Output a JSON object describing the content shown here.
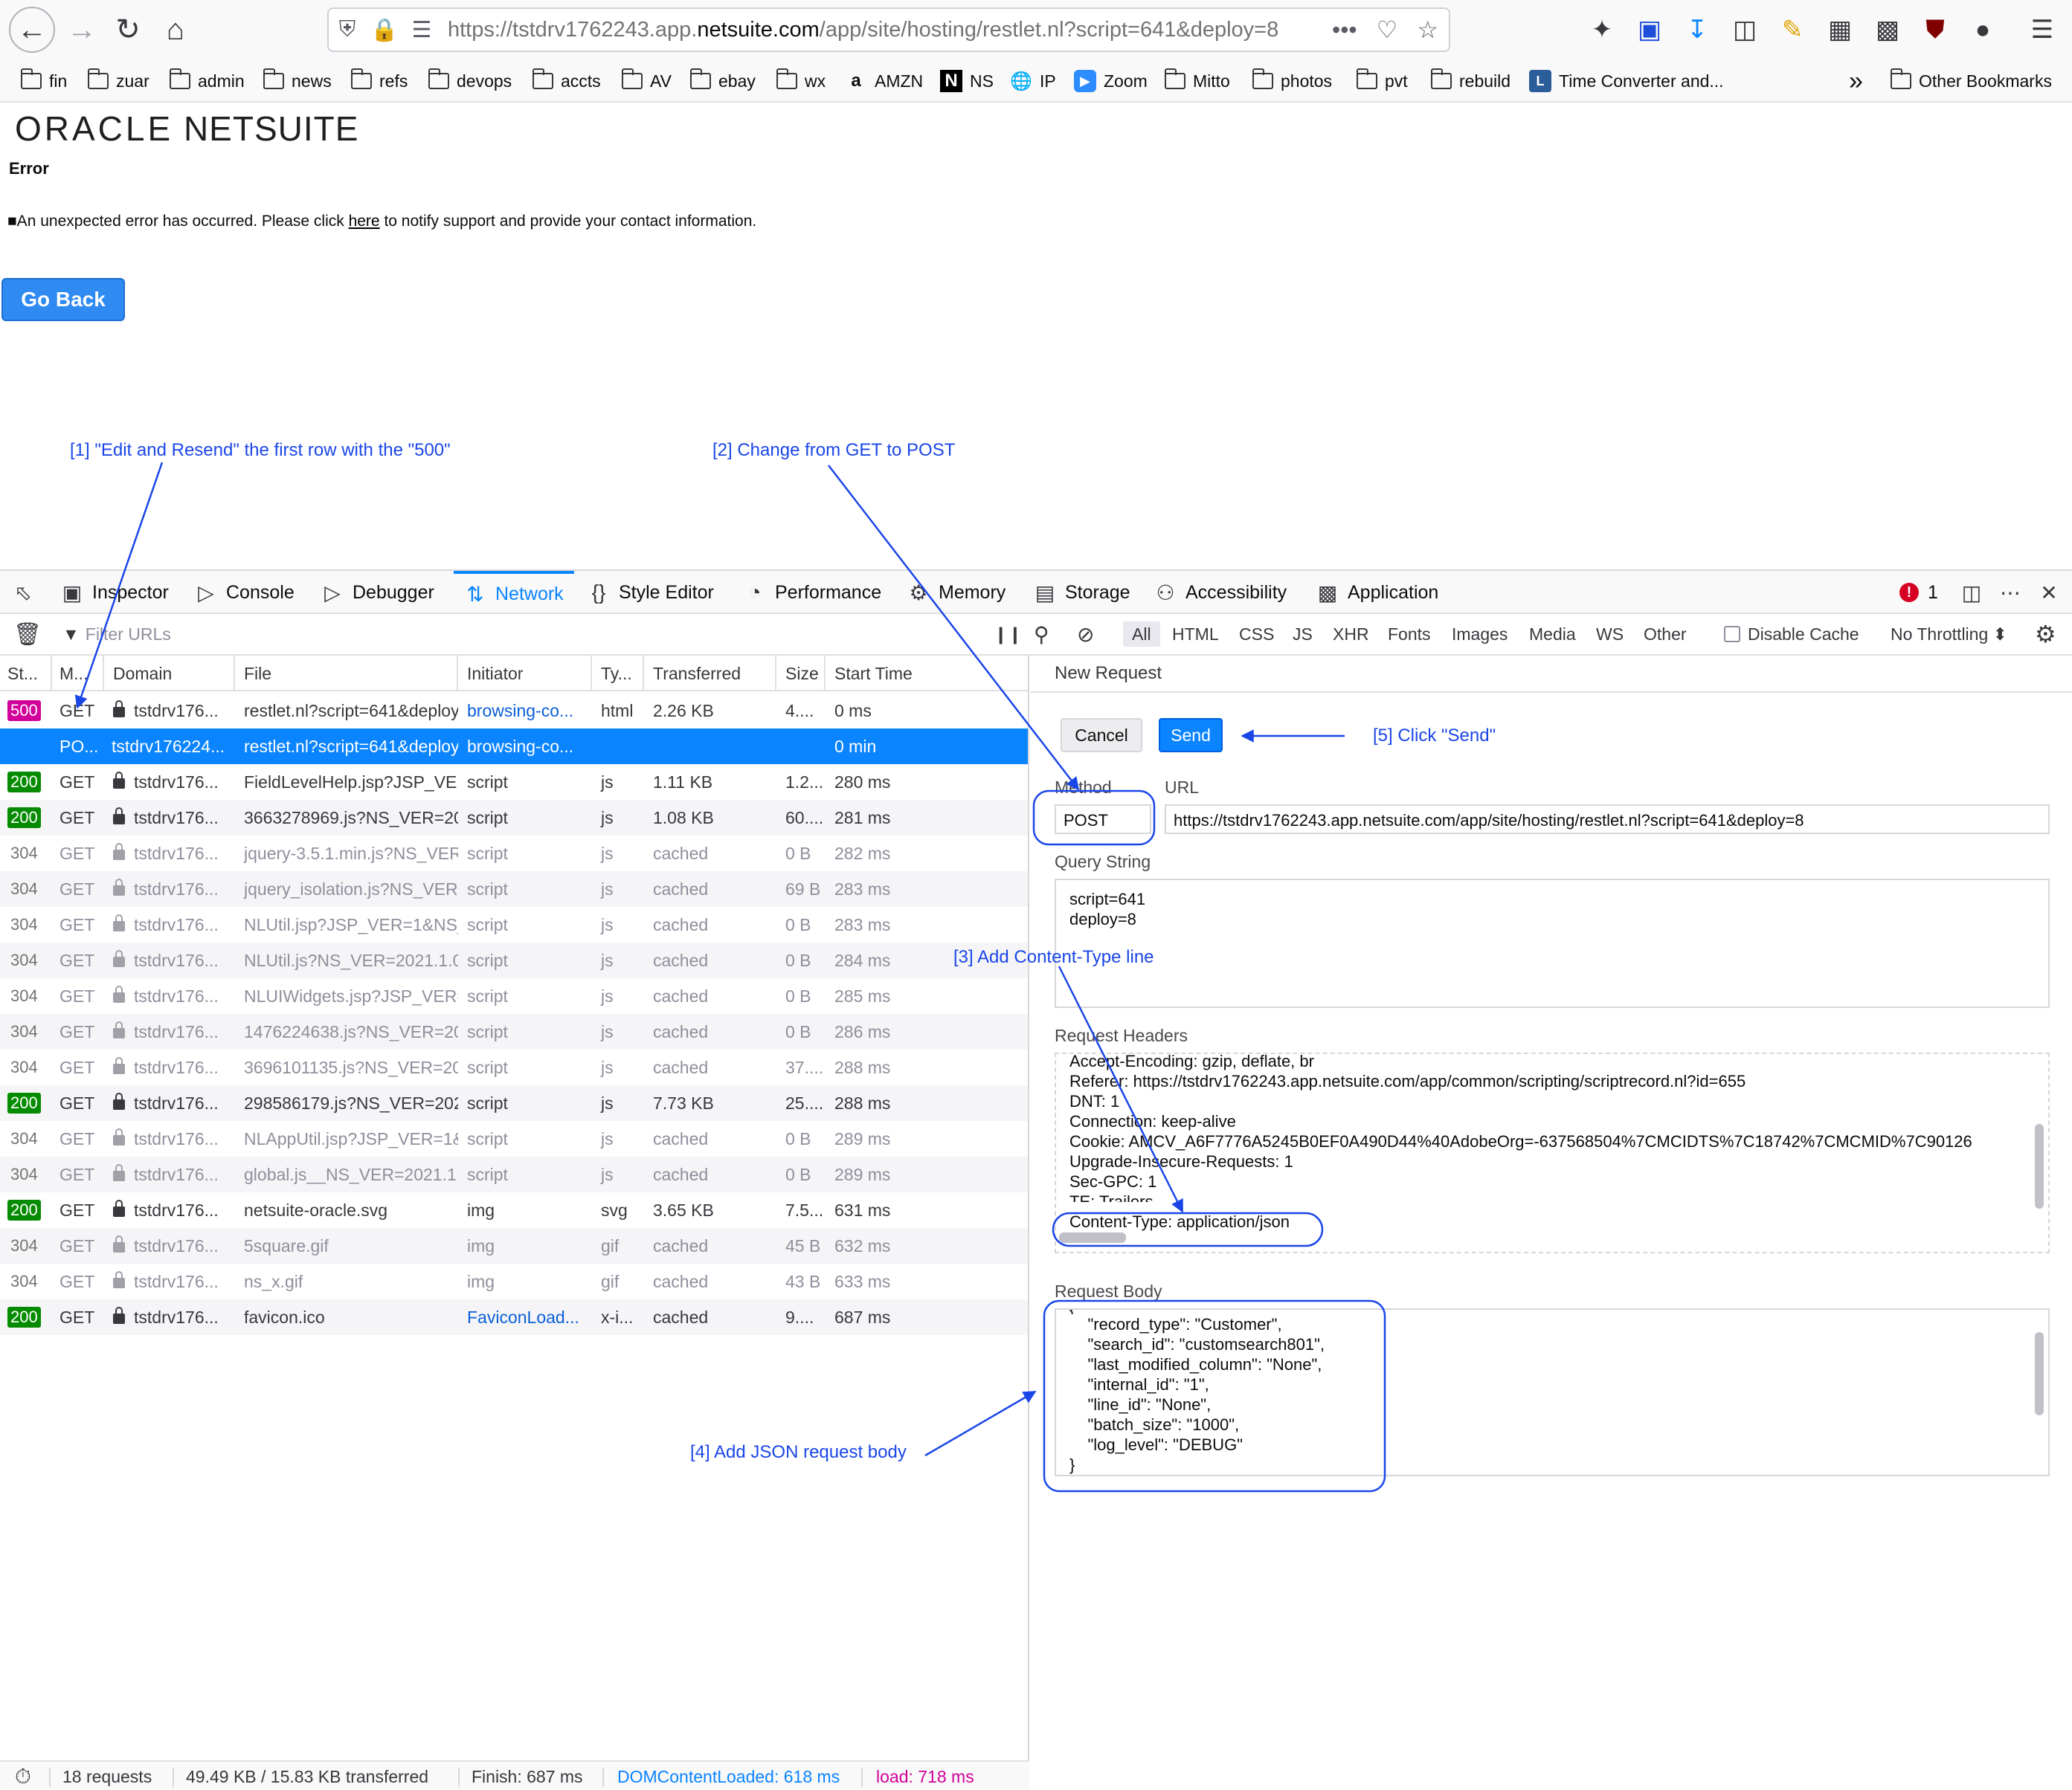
{
  "browser": {
    "url_prefix": "https://tstdrv1762243.app.",
    "url_domain": "netsuite.com",
    "url_path": "/app/site/hosting/restlet.nl?script=641&deploy=8",
    "url_more": "•••",
    "bookmarks": [
      "fin",
      "zuar",
      "admin",
      "news",
      "refs",
      "devops",
      "accts",
      "AV",
      "ebay",
      "wx",
      "AMZN",
      "NS",
      "IP",
      "Zoom",
      "Mitto",
      "photos",
      "pvt",
      "rebuild",
      "Time Converter and...",
      "Other Bookmarks"
    ],
    "bookmarks_more": "»"
  },
  "page": {
    "logo_oracle": "ORACLE",
    "logo_netsuite": "NETSUITE",
    "error_title": "Error",
    "error_prefix": "■An unexpected error has occurred. Please click ",
    "error_link": "here",
    "error_suffix": " to notify support and provide your contact information.",
    "go_back": "Go Back"
  },
  "annotations": {
    "step1": "[1] \"Edit and Resend\" the first row with the \"500\"",
    "step2": "[2] Change from GET to POST",
    "step3": "[3] Add Content-Type line",
    "step4": "[4] Add JSON request body",
    "step5": "[5] Click \"Send\""
  },
  "devtools": {
    "tabs": [
      "Inspector",
      "Console",
      "Debugger",
      "Network",
      "Style Editor",
      "Performance",
      "Memory",
      "Storage",
      "Accessibility",
      "Application"
    ],
    "error_count": "1",
    "filter_placeholder": "Filter URLs",
    "type_filters": [
      "All",
      "HTML",
      "CSS",
      "JS",
      "XHR",
      "Fonts",
      "Images",
      "Media",
      "WS",
      "Other"
    ],
    "disable_cache": "Disable Cache",
    "throttling": "No Throttling ⬍",
    "columns": [
      "St...",
      "M...",
      "Domain",
      "File",
      "Initiator",
      "Ty...",
      "Transferred",
      "Size",
      "Start Time"
    ],
    "rows": [
      {
        "status": "500",
        "method": "GET",
        "domain": "tstdrv176...",
        "file": "restlet.nl?script=641&deploy",
        "initiator": "browsing-co...",
        "type": "html",
        "transferred": "2.26 KB",
        "size": "4....",
        "start": "0 ms"
      },
      {
        "status": "",
        "method": "PO...",
        "domain": "tstdrv176224...",
        "file": "restlet.nl?script=641&deploy",
        "initiator": "browsing-co...",
        "type": "",
        "transferred": "",
        "size": "",
        "start": "0 min"
      },
      {
        "status": "200",
        "method": "GET",
        "domain": "tstdrv176...",
        "file": "FieldLevelHelp.jsp?JSP_VER",
        "initiator": "script",
        "type": "js",
        "transferred": "1.11 KB",
        "size": "1.2...",
        "start": "280 ms"
      },
      {
        "status": "200",
        "method": "GET",
        "domain": "tstdrv176...",
        "file": "3663278969.js?NS_VER=20",
        "initiator": "script",
        "type": "js",
        "transferred": "1.08 KB",
        "size": "60....",
        "start": "281 ms"
      },
      {
        "status": "304",
        "method": "GET",
        "domain": "tstdrv176...",
        "file": "jquery-3.5.1.min.js?NS_VER=",
        "initiator": "script",
        "type": "js",
        "transferred": "cached",
        "size": "0 B",
        "start": "282 ms"
      },
      {
        "status": "304",
        "method": "GET",
        "domain": "tstdrv176...",
        "file": "jquery_isolation.js?NS_VER=",
        "initiator": "script",
        "type": "js",
        "transferred": "cached",
        "size": "69 B",
        "start": "283 ms"
      },
      {
        "status": "304",
        "method": "GET",
        "domain": "tstdrv176...",
        "file": "NLUtil.jsp?JSP_VER=1&NS_V",
        "initiator": "script",
        "type": "js",
        "transferred": "cached",
        "size": "0 B",
        "start": "283 ms"
      },
      {
        "status": "304",
        "method": "GET",
        "domain": "tstdrv176...",
        "file": "NLUtil.js?NS_VER=2021.1.0&",
        "initiator": "script",
        "type": "js",
        "transferred": "cached",
        "size": "0 B",
        "start": "284 ms"
      },
      {
        "status": "304",
        "method": "GET",
        "domain": "tstdrv176...",
        "file": "NLUIWidgets.jsp?JSP_VER=1",
        "initiator": "script",
        "type": "js",
        "transferred": "cached",
        "size": "0 B",
        "start": "285 ms"
      },
      {
        "status": "304",
        "method": "GET",
        "domain": "tstdrv176...",
        "file": "1476224638.js?NS_VER=20",
        "initiator": "script",
        "type": "js",
        "transferred": "cached",
        "size": "0 B",
        "start": "286 ms"
      },
      {
        "status": "304",
        "method": "GET",
        "domain": "tstdrv176...",
        "file": "3696101135.js?NS_VER=202",
        "initiator": "script",
        "type": "js",
        "transferred": "cached",
        "size": "37....",
        "start": "288 ms"
      },
      {
        "status": "200",
        "method": "GET",
        "domain": "tstdrv176...",
        "file": "298586179.js?NS_VER=202",
        "initiator": "script",
        "type": "js",
        "transferred": "7.73 KB",
        "size": "25....",
        "start": "288 ms"
      },
      {
        "status": "304",
        "method": "GET",
        "domain": "tstdrv176...",
        "file": "NLAppUtil.jsp?JSP_VER=1&N",
        "initiator": "script",
        "type": "js",
        "transferred": "cached",
        "size": "0 B",
        "start": "289 ms"
      },
      {
        "status": "304",
        "method": "GET",
        "domain": "tstdrv176...",
        "file": "global.js__NS_VER=2021.1.0",
        "initiator": "script",
        "type": "js",
        "transferred": "cached",
        "size": "0 B",
        "start": "289 ms"
      },
      {
        "status": "200",
        "method": "GET",
        "domain": "tstdrv176...",
        "file": "netsuite-oracle.svg",
        "initiator": "img",
        "type": "svg",
        "transferred": "3.65 KB",
        "size": "7.5...",
        "start": "631 ms"
      },
      {
        "status": "304",
        "method": "GET",
        "domain": "tstdrv176...",
        "file": "5square.gif",
        "initiator": "img",
        "type": "gif",
        "transferred": "cached",
        "size": "45 B",
        "start": "632 ms"
      },
      {
        "status": "304",
        "method": "GET",
        "domain": "tstdrv176...",
        "file": "ns_x.gif",
        "initiator": "img",
        "type": "gif",
        "transferred": "cached",
        "size": "43 B",
        "start": "633 ms"
      },
      {
        "status": "200",
        "method": "GET",
        "domain": "tstdrv176...",
        "file": "favicon.ico",
        "initiator": "FaviconLoad...",
        "type": "x-i...",
        "transferred": "cached",
        "size": "9....",
        "start": "687 ms"
      }
    ],
    "status_bar": {
      "requests": "18 requests",
      "size": "49.49 KB / 15.83 KB transferred",
      "finish": "Finish: 687 ms",
      "dcl": "DOMContentLoaded: 618 ms",
      "load": "load: 718 ms"
    },
    "new_request": {
      "title": "New Request",
      "cancel": "Cancel",
      "send": "Send",
      "method_label": "Method",
      "url_label": "URL",
      "method": "POST",
      "url": "https://tstdrv1762243.app.netsuite.com/app/site/hosting/restlet.nl?script=641&deploy=8",
      "query_label": "Query String",
      "query_lines": [
        "script=641",
        "deploy=8"
      ],
      "headers_label": "Request Headers",
      "header_lines": [
        "Accept-Encoding: gzip, deflate, br",
        "Referer: https://tstdrv1762243.app.netsuite.com/app/common/scripting/scriptrecord.nl?id=655",
        "DNT: 1",
        "Connection: keep-alive",
        "Cookie: AMCV_A6F7776A5245B0EF0A490D44%40AdobeOrg=-637568504%7CMCIDTS%7C18742%7CMCMID%7C90126",
        "Upgrade-Insecure-Requests: 1",
        "Sec-GPC: 1",
        "TE: Trailers",
        "Content-Type: application/json"
      ],
      "body_label": "Request Body",
      "body_lines": [
        "{",
        "    \"record_type\": \"Customer\",",
        "    \"search_id\": \"customsearch801\",",
        "    \"last_modified_column\": \"None\",",
        "    \"internal_id\": \"1\",",
        "    \"line_id\": \"None\",",
        "    \"batch_size\": \"1000\",",
        "    \"log_level\": \"DEBUG\"",
        "}"
      ]
    }
  },
  "colors": {
    "accent": "#0a84ff",
    "status_500": "#d1009a",
    "status_200": "#058b00",
    "annotation": "#1a46e8",
    "go_back": "#2f8af2"
  }
}
